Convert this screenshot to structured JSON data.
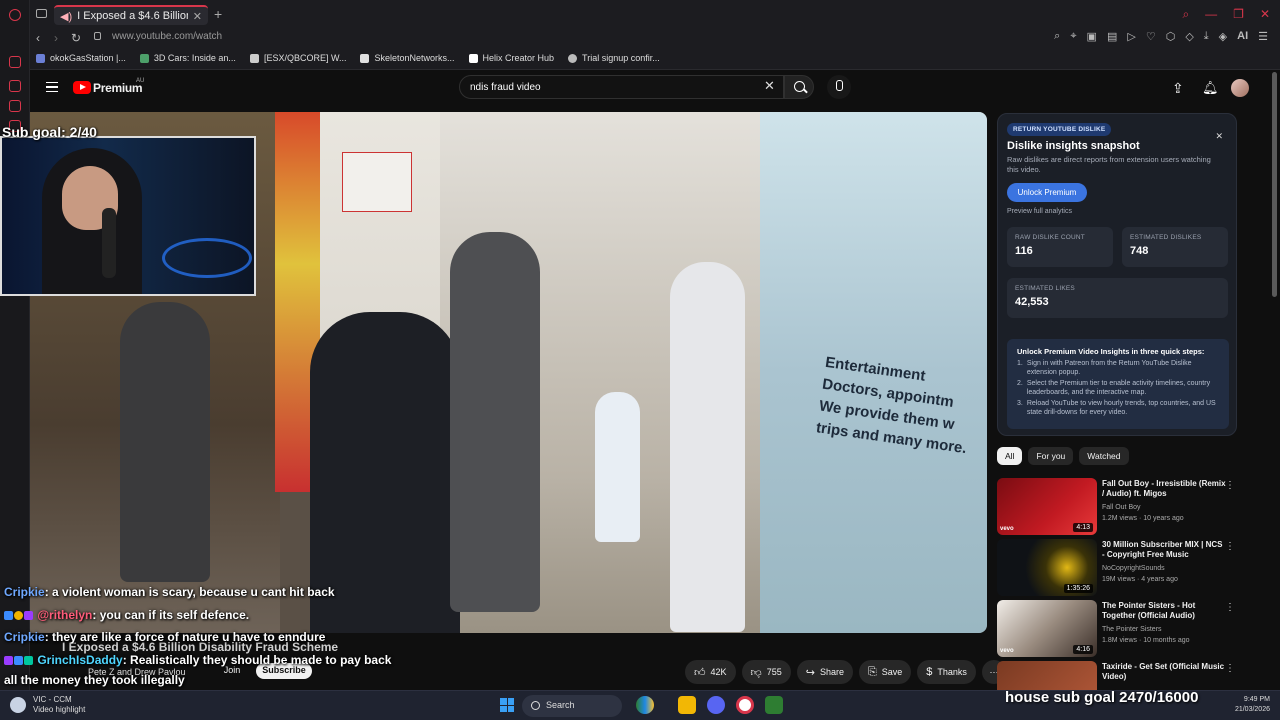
{
  "browser": {
    "tab_title": "I Exposed a $4.6 Billion",
    "url": "www.youtube.com/watch",
    "bookmarks": [
      "okokGasStation |...",
      "3D Cars: Inside an...",
      "[ESX/QBCORE] W...",
      "SkeletonNetworks...",
      "Helix Creator Hub",
      "Trial signup confir..."
    ],
    "ai_label": "AI"
  },
  "youtube": {
    "brand": "Premium",
    "brand_region": "AU",
    "search_value": "ndis fraud video",
    "video": {
      "title": "I Exposed a $4.6 Billion Disability Fraud Scheme",
      "channel": "Pete Z and Drew Pavlou",
      "join_label": "Join",
      "subscribe_label": "Subscribe",
      "sign_lines": [
        "Entertainment",
        "Doctors, appointm",
        "We provide them w",
        "trips and many more."
      ],
      "actions": {
        "likes": "42K",
        "dislikes": "755",
        "share": "Share",
        "save": "Save",
        "thanks": "Thanks"
      }
    },
    "dislike_panel": {
      "badge": "RETURN YOUTUBE DISLIKE",
      "title": "Dislike insights snapshot",
      "subtitle": "Raw dislikes are direct reports from extension users watching this video.",
      "unlock_label": "Unlock Premium",
      "preview_label": "Preview full analytics",
      "raw_label": "RAW DISLIKE COUNT",
      "raw_value": "116",
      "est_dislikes_label": "ESTIMATED DISLIKES",
      "est_dislikes_value": "748",
      "est_likes_label": "ESTIMATED LIKES",
      "est_likes_value": "42,553",
      "steps_title": "Unlock Premium Video Insights in three quick steps:",
      "steps": [
        "Sign in with Patreon from the Return YouTube Dislike extension popup.",
        "Select the Premium tier to enable activity timelines, country leaderboards, and the interactive map.",
        "Reload YouTube to view hourly trends, top countries, and US state drill-downs for every video."
      ]
    },
    "chips": [
      "All",
      "For you",
      "Watched"
    ],
    "recommended": [
      {
        "title": "Fall Out Boy - Irresistible (Remix / Audio) ft. Migos",
        "channel": "Fall Out Boy",
        "meta": "1.2M views · 10 years ago",
        "duration": "4:13",
        "color": "#c21a22",
        "vevo": "vevo"
      },
      {
        "title": "30 Million Subscriber MIX | NCS - Copyright Free Music",
        "channel": "NoCopyrightSounds",
        "meta": "19M views · 4 years ago",
        "duration": "1:35:26",
        "color": "#101418",
        "vevo": ""
      },
      {
        "title": "The Pointer Sisters - Hot Together (Official Audio)",
        "channel": "The Pointer Sisters",
        "meta": "1.8M views · 10 months ago",
        "duration": "4:16",
        "color": "#e8e2dc",
        "vevo": "vevo"
      },
      {
        "title": "Taxiride - Get Set (Official Music Video)",
        "channel": "",
        "meta": "",
        "duration": "",
        "color": "#b65a3a",
        "vevo": ""
      }
    ]
  },
  "stream": {
    "sub_goal": "Sub goal: 2/40",
    "house_goal": "house sub goal 2470/16000",
    "chat": [
      {
        "user": "Cripkie",
        "text": ": a violent woman is scary, because u cant hit back",
        "style": ""
      },
      {
        "user": "@rithelyn",
        "text": ": you can if its self defence.",
        "style": "pink"
      },
      {
        "user": "Cripkie",
        "text": ": they are like a force of nature u have to enndure",
        "style": ""
      },
      {
        "user": "GrinchIsDaddy",
        "text": ": Realistically they should be made to pay back",
        "style": "cyan"
      },
      {
        "user": "",
        "text": "all the money they took illegally",
        "style": ""
      }
    ]
  },
  "taskbar": {
    "weather_title": "VIC - CCM",
    "weather_sub": "Video highlight",
    "search_label": "Search",
    "time": "9:49 PM",
    "date": "21/03/2026"
  }
}
